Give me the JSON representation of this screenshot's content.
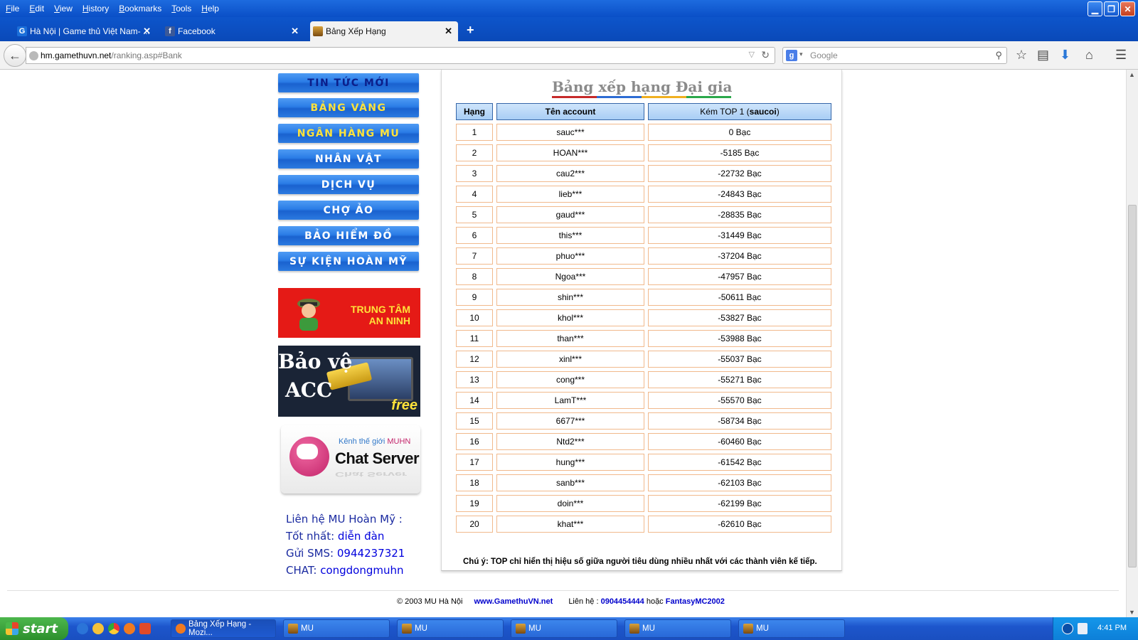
{
  "browser": {
    "menu": [
      "File",
      "Edit",
      "View",
      "History",
      "Bookmarks",
      "Tools",
      "Help"
    ],
    "tabs": [
      {
        "label": "Hà Nội | Game thủ Việt Nam- ...",
        "icon": "G"
      },
      {
        "label": "Facebook",
        "icon": "f"
      },
      {
        "label": "Bảng Xếp Hạng",
        "icon": ""
      }
    ],
    "url_host": "hm.gamethuvn.net",
    "url_path": "/ranking.asp#Bank",
    "search_placeholder": "Google"
  },
  "sidebar": {
    "menu": [
      {
        "label": "TIN TỨC MỚI",
        "color": "#0b1e8a"
      },
      {
        "label": "BẢNG VÀNG",
        "color": "#ffe23a"
      },
      {
        "label": "NGÂN HÀNG MU",
        "color": "#ffe23a"
      },
      {
        "label": "NHÂN VẬT",
        "color": "#ffffff"
      },
      {
        "label": "DỊCH VỤ",
        "color": "#ffffff"
      },
      {
        "label": "CHỢ ẢO",
        "color": "#ffffff"
      },
      {
        "label": "BẢO HIỂM ĐỒ",
        "color": "#ffffff"
      },
      {
        "label": "SỰ KIỆN HOÀN MỸ",
        "color": "#ffffff"
      }
    ],
    "security_banner": {
      "line1": "TRUNG TÂM",
      "line2": "AN NINH"
    },
    "acc_banner": {
      "line1": "Bảo vệ",
      "line2": "ACC",
      "tag": "free"
    },
    "chat_banner": {
      "small_prefix": "Kênh thế giới",
      "small_brand": "MUHN",
      "big": "Chat Server"
    },
    "contact": {
      "heading": "Liên hệ MU Hoàn Mỹ :",
      "best_label": "Tốt nhất:",
      "best_value": "diễn đàn",
      "sms_label": "Gửi SMS:",
      "sms_value": "0944237321",
      "chat_label": "CHAT:",
      "chat_value": "congdongmuhn"
    }
  },
  "ranking": {
    "title": "Bảng xếp hạng Đại gia",
    "headers": {
      "rank": "Hạng",
      "account": "Tên account",
      "gap_prefix": "Kém TOP 1 (",
      "gap_name": "saucoi",
      "gap_suffix": ")"
    },
    "rows": [
      {
        "rank": "1",
        "account": "sauc***",
        "gap": "0 Bạc"
      },
      {
        "rank": "2",
        "account": "HOAN***",
        "gap": "-5185 Bạc"
      },
      {
        "rank": "3",
        "account": "cau2***",
        "gap": "-22732 Bạc"
      },
      {
        "rank": "4",
        "account": "lieb***",
        "gap": "-24843 Bạc"
      },
      {
        "rank": "5",
        "account": "gaud***",
        "gap": "-28835 Bạc"
      },
      {
        "rank": "6",
        "account": "this***",
        "gap": "-31449 Bạc"
      },
      {
        "rank": "7",
        "account": "phuo***",
        "gap": "-37204 Bạc"
      },
      {
        "rank": "8",
        "account": "Ngoa***",
        "gap": "-47957 Bạc"
      },
      {
        "rank": "9",
        "account": "shin***",
        "gap": "-50611 Bạc"
      },
      {
        "rank": "10",
        "account": "khol***",
        "gap": "-53827 Bạc"
      },
      {
        "rank": "11",
        "account": "than***",
        "gap": "-53988 Bạc"
      },
      {
        "rank": "12",
        "account": "xinl***",
        "gap": "-55037 Bạc"
      },
      {
        "rank": "13",
        "account": "cong***",
        "gap": "-55271 Bạc"
      },
      {
        "rank": "14",
        "account": "LamT***",
        "gap": "-55570 Bạc"
      },
      {
        "rank": "15",
        "account": "6677***",
        "gap": "-58734 Bạc"
      },
      {
        "rank": "16",
        "account": "Ntd2***",
        "gap": "-60460 Bạc"
      },
      {
        "rank": "17",
        "account": "hung***",
        "gap": "-61542 Bạc"
      },
      {
        "rank": "18",
        "account": "sanb***",
        "gap": "-62103 Bạc"
      },
      {
        "rank": "19",
        "account": "doin***",
        "gap": "-62199 Bạc"
      },
      {
        "rank": "20",
        "account": "khat***",
        "gap": "-62610 Bạc"
      }
    ],
    "note": "Chú ý: TOP chỉ hiển thị hiệu số giữa người tiêu dùng nhiều nhất với các thành viên kế tiếp."
  },
  "footer": {
    "copyright": "© 2003 MU Hà Nội",
    "site": "www.GamethuVN.net",
    "contact_label": "Liên hệ :",
    "phone": "0904454444",
    "or": "hoặc",
    "alt": "FantasyMC2002"
  },
  "taskbar": {
    "start": "start",
    "tasks": [
      "Bảng Xếp Hạng - Mozi...",
      "MU",
      "MU",
      "MU",
      "MU",
      "MU"
    ],
    "clock": "4:41 PM"
  }
}
